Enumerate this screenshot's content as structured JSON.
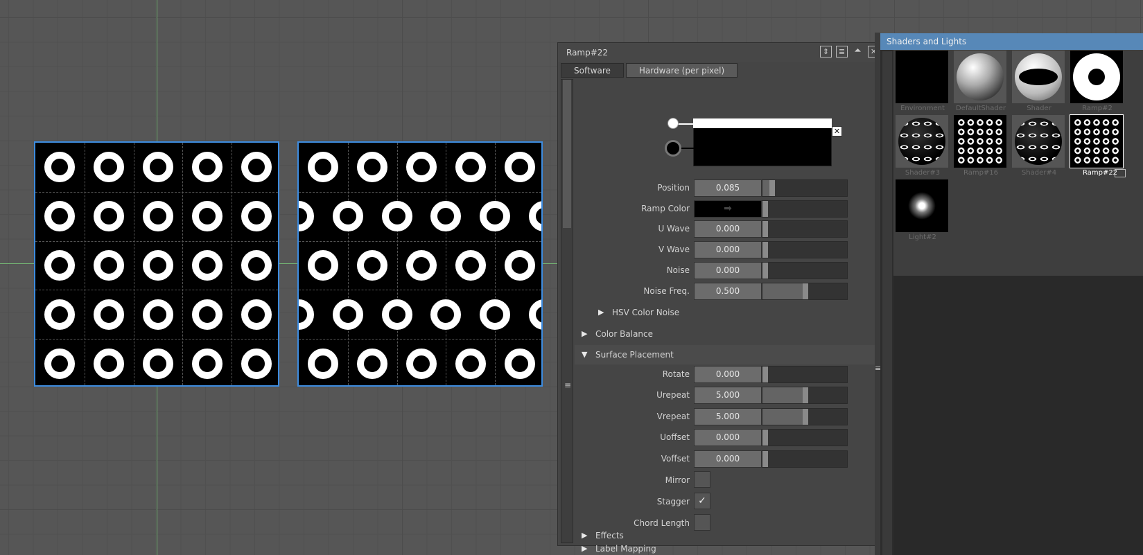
{
  "editor": {
    "title": "Ramp#22",
    "tabs": [
      {
        "label": "Software",
        "active": false
      },
      {
        "label": "Hardware (per pixel)",
        "active": true
      }
    ],
    "fields": {
      "position": {
        "label": "Position",
        "value": "0.085",
        "fraction": 0.085
      },
      "ramp_color": {
        "label": "Ramp Color",
        "icon": "arrow-right-icon"
      },
      "u_wave": {
        "label": "U Wave",
        "value": "0.000",
        "fraction": 0.0
      },
      "v_wave": {
        "label": "V Wave",
        "value": "0.000",
        "fraction": 0.0
      },
      "noise": {
        "label": "Noise",
        "value": "0.000",
        "fraction": 0.0
      },
      "noise_freq": {
        "label": "Noise Freq.",
        "value": "0.500",
        "fraction": 0.5
      }
    },
    "sections": {
      "hsv_color_noise": {
        "label": "HSV Color Noise",
        "expanded": false
      },
      "color_balance": {
        "label": "Color Balance",
        "expanded": false
      },
      "surface_placement": {
        "label": "Surface Placement",
        "expanded": true
      },
      "label_mapping": {
        "label": "Label Mapping",
        "expanded": false
      },
      "effects": {
        "label": "Effects",
        "expanded": false
      }
    },
    "placement": {
      "rotate": {
        "label": "Rotate",
        "value": "0.000",
        "fraction": 0.0
      },
      "urepeat": {
        "label": "Urepeat",
        "value": "5.000",
        "fraction": 0.5
      },
      "vrepeat": {
        "label": "Vrepeat",
        "value": "5.000",
        "fraction": 0.5
      },
      "uoffset": {
        "label": "Uoffset",
        "value": "0.000",
        "fraction": 0.0
      },
      "voffset": {
        "label": "Voffset",
        "value": "0.000",
        "fraction": 0.0
      },
      "mirror": {
        "label": "Mirror",
        "checked": false
      },
      "stagger": {
        "label": "Stagger",
        "checked": true
      },
      "chord_length": {
        "label": "Chord Length",
        "checked": false
      }
    },
    "check_glyph": "✓"
  },
  "shaders_panel": {
    "title": "Shaders and Lights",
    "items": [
      {
        "label": "Environment",
        "kind": "black"
      },
      {
        "label": "DefaultShader",
        "kind": "grey-sphere"
      },
      {
        "label": "Shader",
        "kind": "eye-sphere"
      },
      {
        "label": "Ramp#2",
        "kind": "ring"
      },
      {
        "label": "Shader#3",
        "kind": "dot-sphere"
      },
      {
        "label": "Ramp#16",
        "kind": "dot-grid"
      },
      {
        "label": "Shader#4",
        "kind": "dot-sphere"
      },
      {
        "label": "Ramp#22",
        "kind": "dot-grid",
        "selected": true
      },
      {
        "label": "Light#2",
        "kind": "light"
      }
    ]
  },
  "colors": {
    "accent": "#5788b8",
    "selection_border": "#3d8ce0",
    "axis": "#7ed07e"
  }
}
